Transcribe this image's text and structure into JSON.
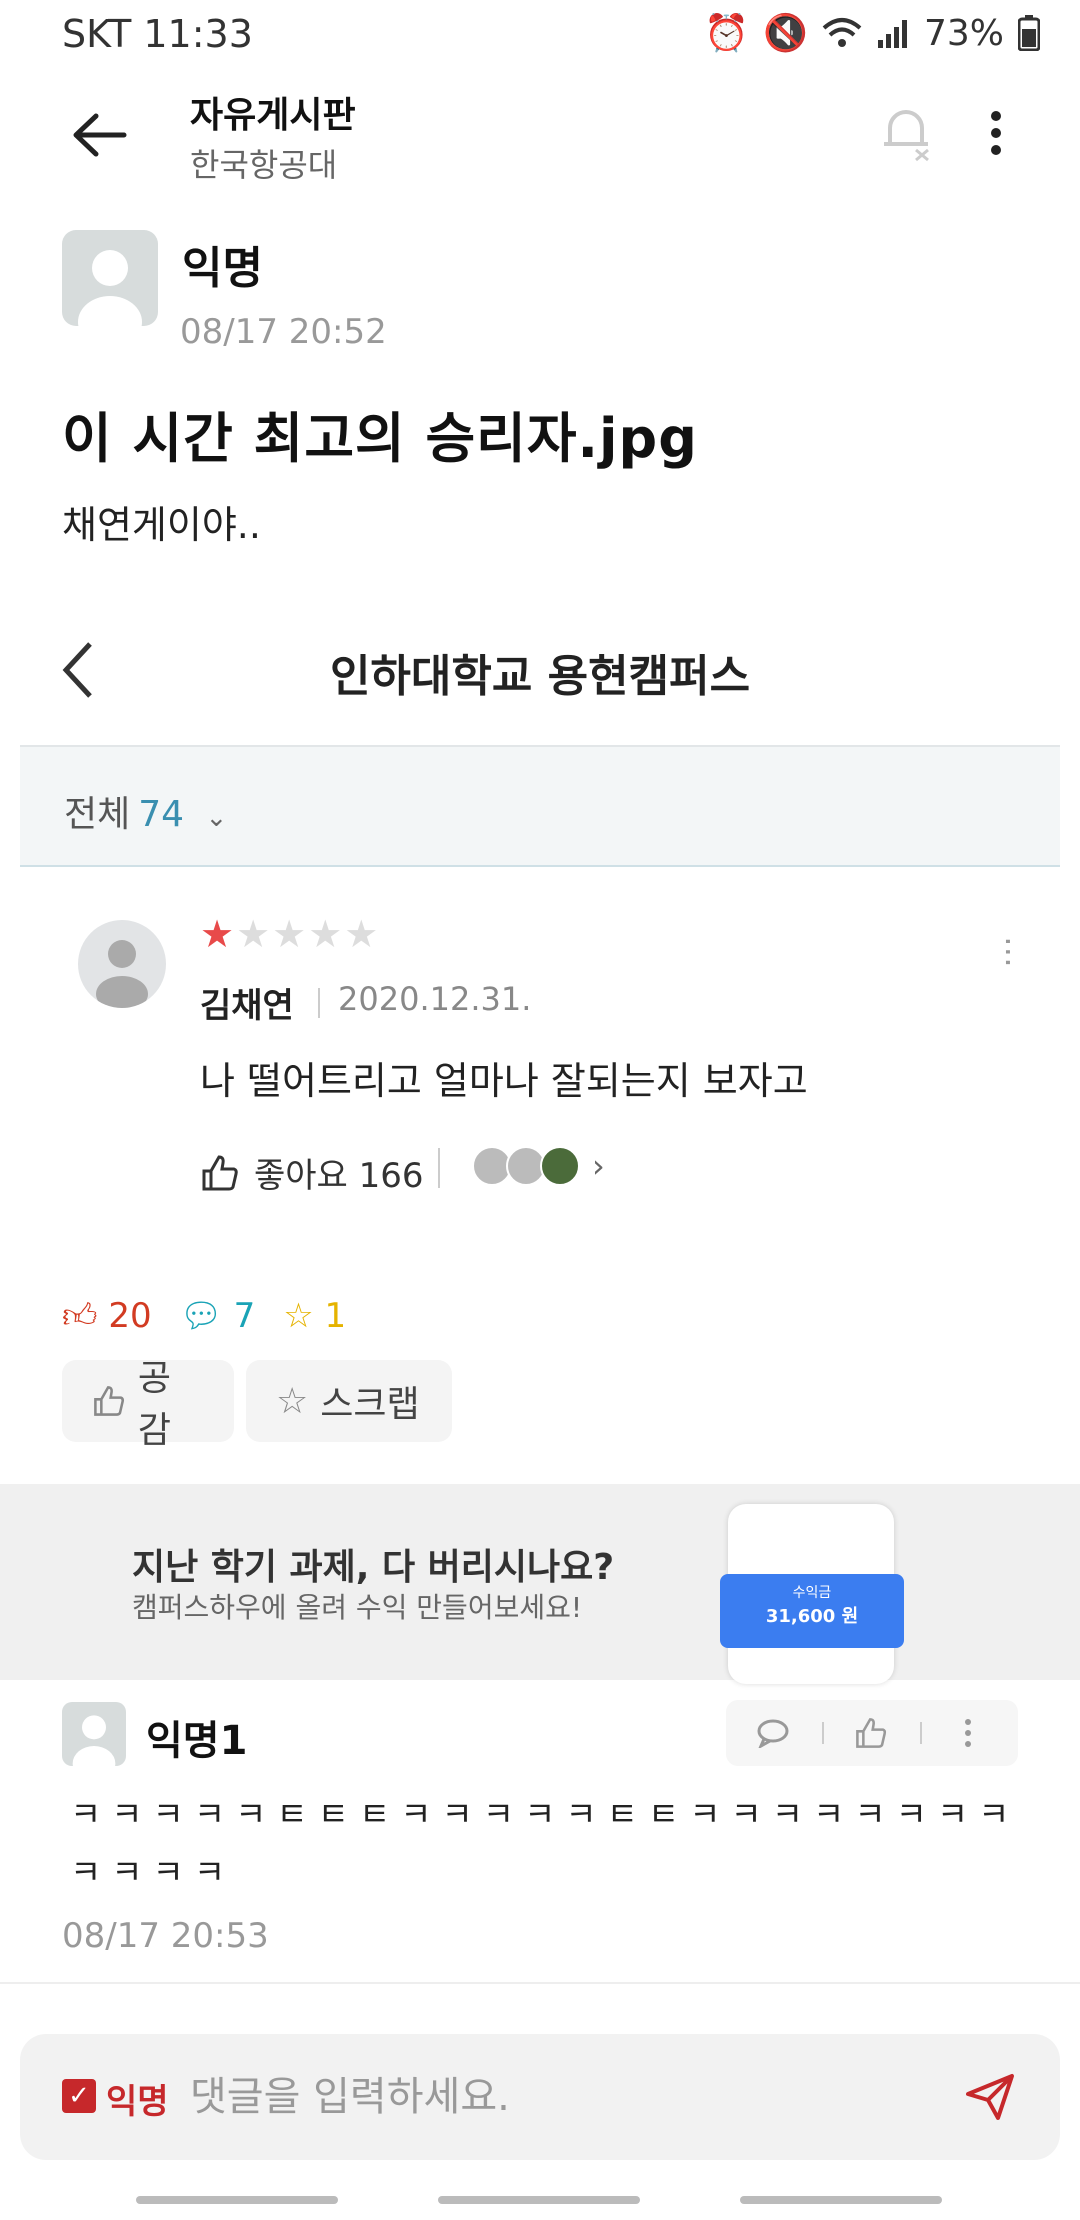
{
  "status_bar": {
    "carrier": "SKT 11:33",
    "battery": "73%"
  },
  "header": {
    "title": "자유게시판",
    "subtitle": "한국항공대"
  },
  "post": {
    "author": "익명",
    "date": "08/17 20:52",
    "title": "이 시간 최고의 승리자.jpg",
    "body": "채연게이야.."
  },
  "embedded": {
    "title": "인하대학교 용현캠퍼스",
    "filter_label": "전체",
    "filter_count": "74",
    "review": {
      "stars_on": "★",
      "stars_off": "★★★★",
      "name": "김채연",
      "date": "2020.12.31.",
      "text": "나 떨어트리고 얼마나 잘되는지 보자고",
      "likes_label": "좋아요 166"
    }
  },
  "counts": {
    "likes": "20",
    "comments": "7",
    "scraps": "1"
  },
  "buttons": {
    "like": "공감",
    "scrap": "스크랩"
  },
  "ad": {
    "headline": "지난 학기 과제, 다 버리시나요?",
    "sub": "캠퍼스하우에 올려 수익 만들어보세요!",
    "card_label": "수익금",
    "card_value": "31,600 원"
  },
  "comment": {
    "author": "익명1",
    "text": "ㅋㅋㅋㅋㅋㅌㅌㅌㅋㅋㅋㅋㅋㅌㅌㅋㅋㅋㅋㅋㅋㅋㅋㅋㅋㅋㅋ",
    "date": "08/17 20:53"
  },
  "input": {
    "anon_label": "익명",
    "placeholder": "댓글을 입력하세요."
  },
  "colors": {
    "accent": "#c6282b",
    "comment_count": "#1aa3b6",
    "scrap_count": "#e5b300"
  }
}
